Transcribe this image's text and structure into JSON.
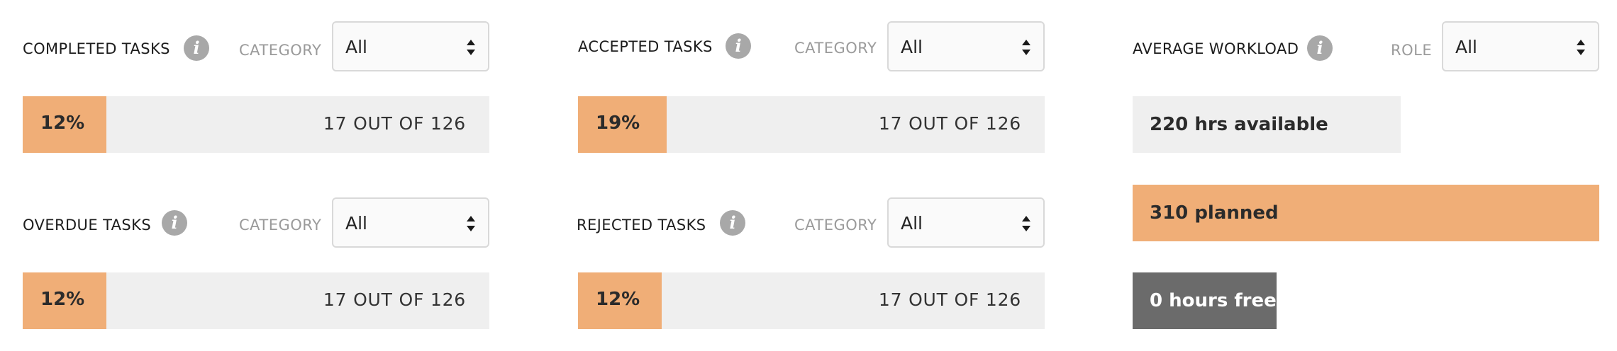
{
  "completed": {
    "title": "COMPLETED TASKS",
    "filter_label": "CATEGORY",
    "filter_value": "All",
    "percent_label": "12%",
    "percent": 12,
    "count_text": "17 OUT OF 126"
  },
  "accepted": {
    "title": "ACCEPTED TASKS",
    "filter_label": "CATEGORY",
    "filter_value": "All",
    "percent_label": "19%",
    "percent": 19,
    "count_text": "17 OUT OF 126"
  },
  "overdue": {
    "title": "OVERDUE TASKS",
    "filter_label": "CATEGORY",
    "filter_value": "All",
    "percent_label": "12%",
    "percent": 12,
    "count_text": "17 OUT OF 126"
  },
  "rejected": {
    "title": "REJECTED TASKS",
    "filter_label": "CATEGORY",
    "filter_value": "All",
    "percent_label": "12%",
    "percent": 12,
    "count_text": "17 OUT OF 126"
  },
  "workload": {
    "title": "AVERAGE WORKLOAD",
    "filter_label": "ROLE",
    "filter_value": "All",
    "available_label": "220 hrs available",
    "available": 220,
    "planned_label": "310 planned",
    "planned": 310,
    "free_label": "0 hours free",
    "free": 0
  },
  "icons": {
    "info": "info-icon",
    "select_arrows": "sort-arrows-icon"
  },
  "colors": {
    "accent": "#f0ae77",
    "track": "#efefef",
    "free": "#6b6b6b",
    "info": "#a8a8a8"
  }
}
